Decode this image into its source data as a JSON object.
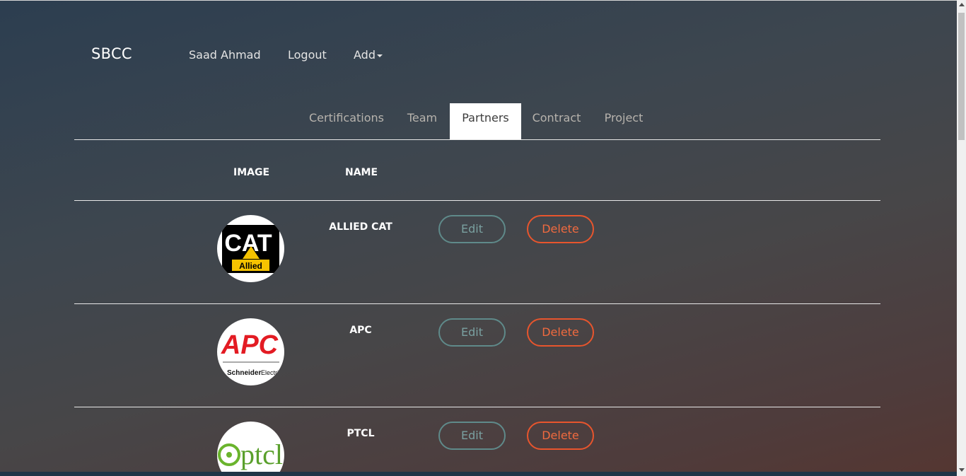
{
  "brand": "SBCC",
  "nav": {
    "user": "Saad Ahmad",
    "logout": "Logout",
    "add": "Add"
  },
  "tabs": [
    {
      "label": "Certifications",
      "active": false
    },
    {
      "label": "Team",
      "active": false
    },
    {
      "label": "Partners",
      "active": true
    },
    {
      "label": "Contract",
      "active": false
    },
    {
      "label": "Project",
      "active": false
    }
  ],
  "table": {
    "headers": [
      "IMAGE",
      "NAME"
    ],
    "rows": [
      {
        "name": "ALLIED CAT",
        "logo_text": [
          "CAT",
          "Allied"
        ],
        "edit": "Edit",
        "delete": "Delete"
      },
      {
        "name": "APC",
        "logo_text": [
          "APC",
          "Schneider",
          "Electric"
        ],
        "edit": "Edit",
        "delete": "Delete"
      },
      {
        "name": "PTCL",
        "logo_text": [
          "ptcl"
        ],
        "edit": "Edit",
        "delete": "Delete"
      }
    ]
  },
  "colors": {
    "edit_border": "#5f8a8a",
    "delete_border": "#e8552d",
    "active_tab_bg": "#ffffff"
  }
}
